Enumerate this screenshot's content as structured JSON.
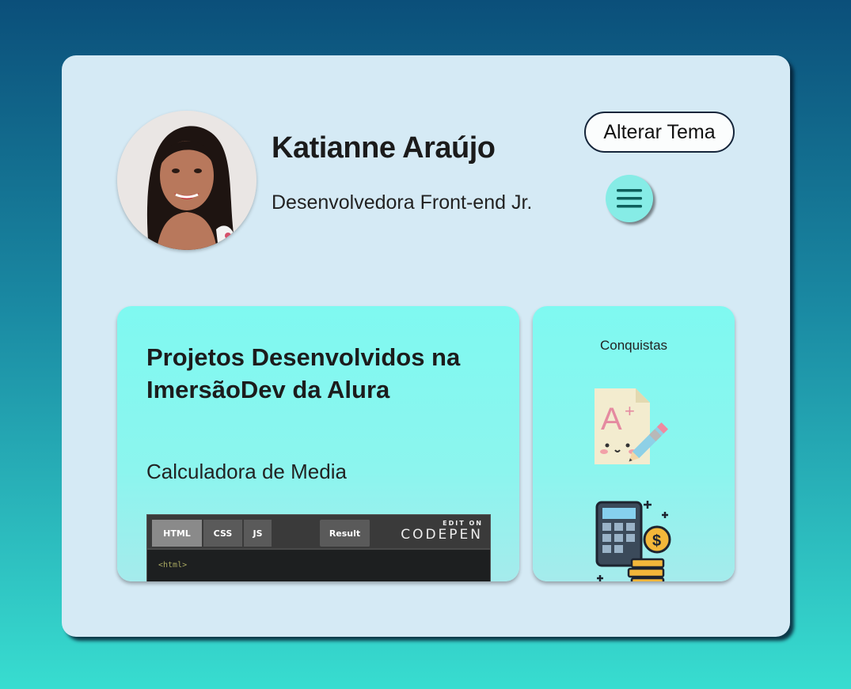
{
  "profile": {
    "name": "Katianne Araújo",
    "role": "Desenvolvedora Front-end Jr."
  },
  "header": {
    "theme_button_label": "Alterar Tema",
    "menu_icon": "hamburger-menu-icon"
  },
  "projects": {
    "title": "Projetos Desenvolvidos na ImersãoDev da Alura",
    "items": [
      {
        "label": "Calculadora de Media",
        "embed": {
          "tabs": [
            "HTML",
            "CSS",
            "JS"
          ],
          "result_tab": "Result",
          "edit_on": "EDIT ON",
          "brand": "CODEPEN",
          "code_line": "<html>"
        }
      }
    ]
  },
  "achievements": {
    "title": "Conquistas",
    "icons": [
      "a-plus-grade-icon",
      "calculator-coins-icon"
    ]
  },
  "colors": {
    "card_bg": "#d5eaf5",
    "panel_accent": "#7ff9f1",
    "menu_button": "#86ece6"
  }
}
